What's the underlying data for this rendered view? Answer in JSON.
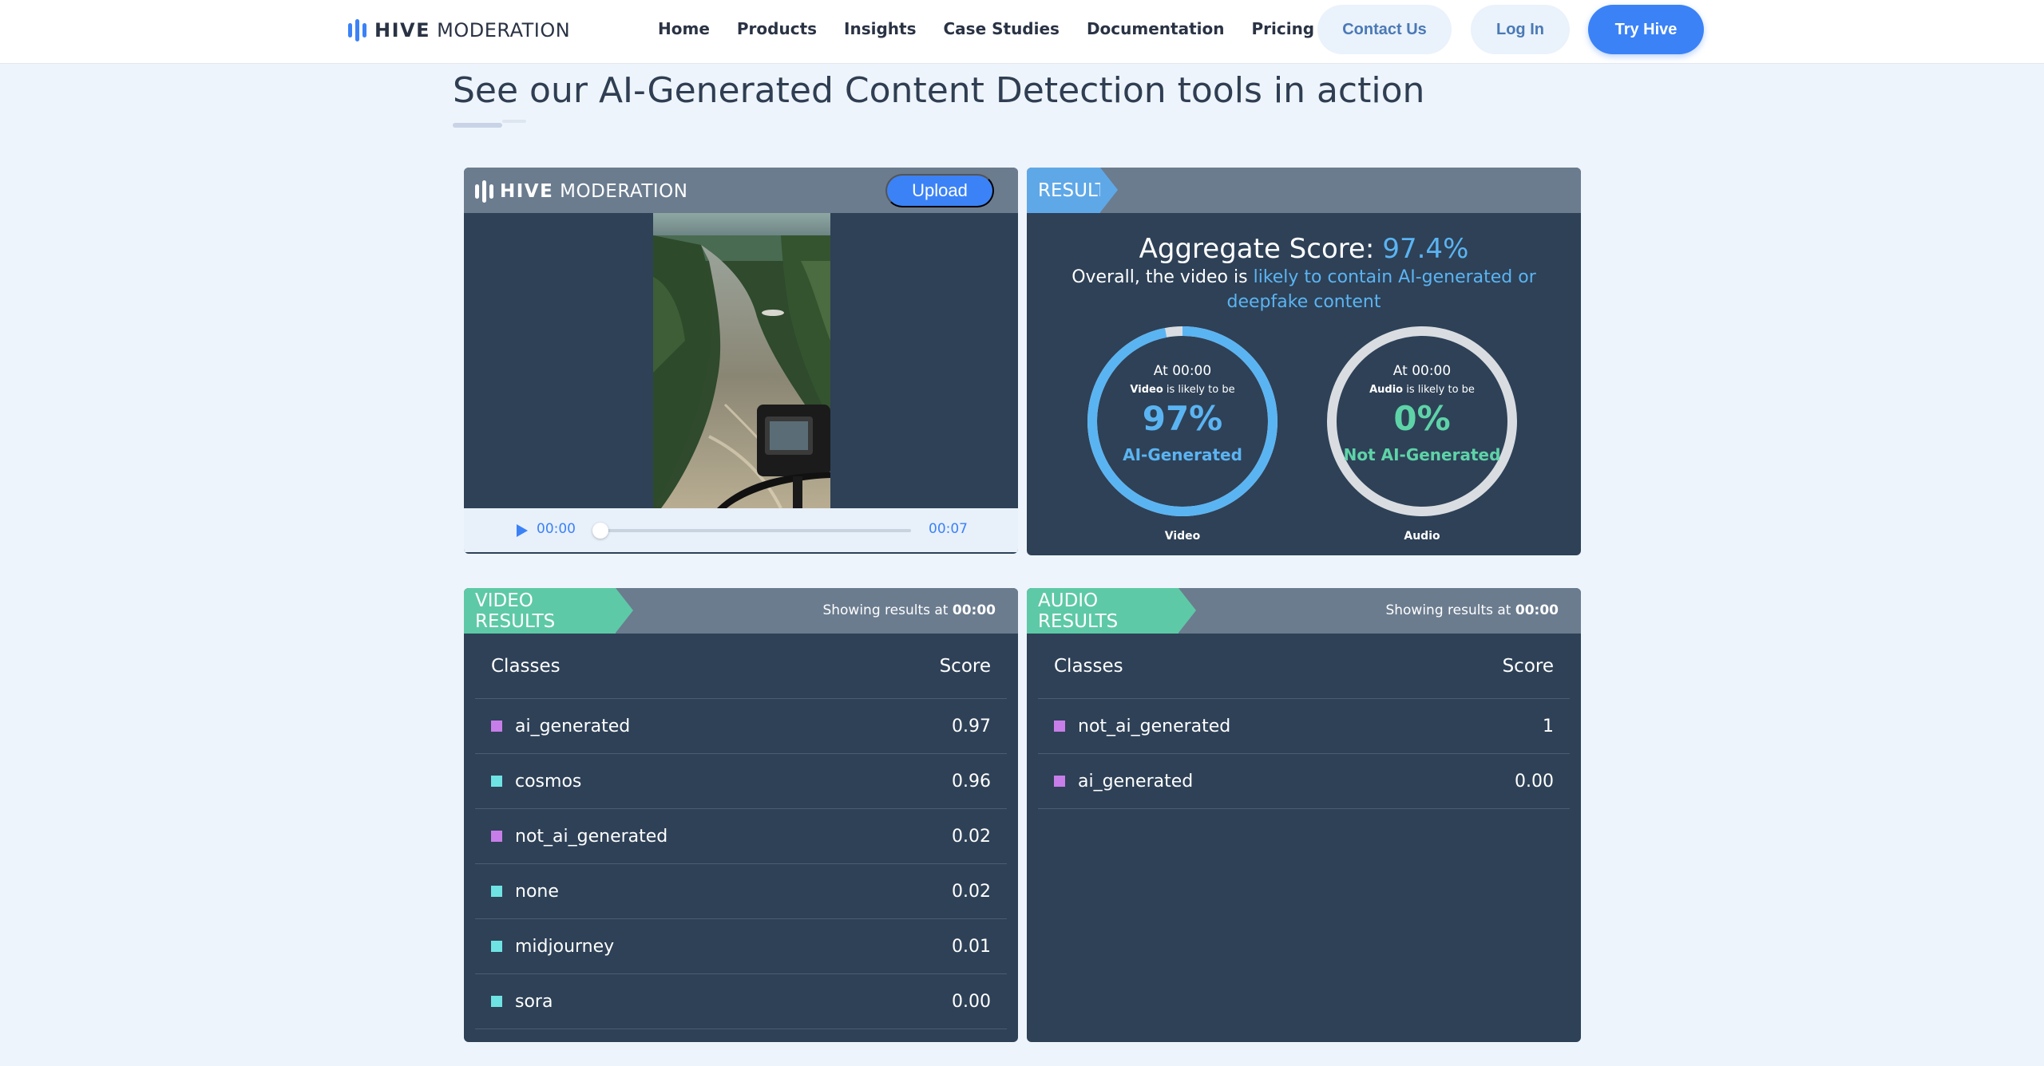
{
  "nav": {
    "logo_bold": "HIVE",
    "logo_light": "MODERATION",
    "links": [
      "Home",
      "Products",
      "Insights",
      "Case Studies",
      "Documentation",
      "Pricing"
    ],
    "contact_label": "Contact Us",
    "login_label": "Log In",
    "try_label": "Try Hive",
    "accent": "#3b82f6"
  },
  "headline": "See our AI-Generated Content Detection tools in action",
  "player": {
    "logo_bold": "HIVE",
    "logo_light": "MODERATION",
    "upload_label": "Upload",
    "current_time": "00:00",
    "duration": "00:07",
    "progress": 0,
    "icons": [
      "play-icon"
    ]
  },
  "result": {
    "tab_label": "RESULT",
    "aggregate_label": "Aggregate Score:",
    "aggregate_value": "97.4%",
    "overall_prefix": "Overall, the video is",
    "overall_verdict": "likely to contain AI-generated or deepfake content",
    "video": {
      "at": "At 00:00",
      "media": "Video",
      "likely": "is likely to be",
      "percent": "97%",
      "fraction": 0.97,
      "class": "AI-Generated",
      "caption": "Video",
      "color": "#5bb4f2"
    },
    "audio": {
      "at": "At 00:00",
      "media": "Audio",
      "likely": "is likely to be",
      "percent": "0%",
      "fraction": 0,
      "class": "Not AI-Generated",
      "caption": "Audio",
      "color": "#5ed3a8"
    }
  },
  "video_results": {
    "tab_label": "VIDEO RESULTS",
    "showing_prefix": "Showing results at",
    "showing_time": "00:00",
    "col_classes": "Classes",
    "col_score": "Score",
    "rows": [
      {
        "name": "ai_generated",
        "score": "0.97",
        "color": "#c77ee8"
      },
      {
        "name": "cosmos",
        "score": "0.96",
        "color": "#6fe3e3"
      },
      {
        "name": "not_ai_generated",
        "score": "0.02",
        "color": "#c77ee8"
      },
      {
        "name": "none",
        "score": "0.02",
        "color": "#6fe3e3"
      },
      {
        "name": "midjourney",
        "score": "0.01",
        "color": "#6fe3e3"
      },
      {
        "name": "sora",
        "score": "0.00",
        "color": "#6fe3e3"
      }
    ]
  },
  "audio_results": {
    "tab_label": "AUDIO RESULTS",
    "showing_prefix": "Showing results at",
    "showing_time": "00:00",
    "col_classes": "Classes",
    "col_score": "Score",
    "rows": [
      {
        "name": "not_ai_generated",
        "score": "1",
        "color": "#c77ee8"
      },
      {
        "name": "ai_generated",
        "score": "0.00",
        "color": "#c77ee8"
      }
    ]
  }
}
